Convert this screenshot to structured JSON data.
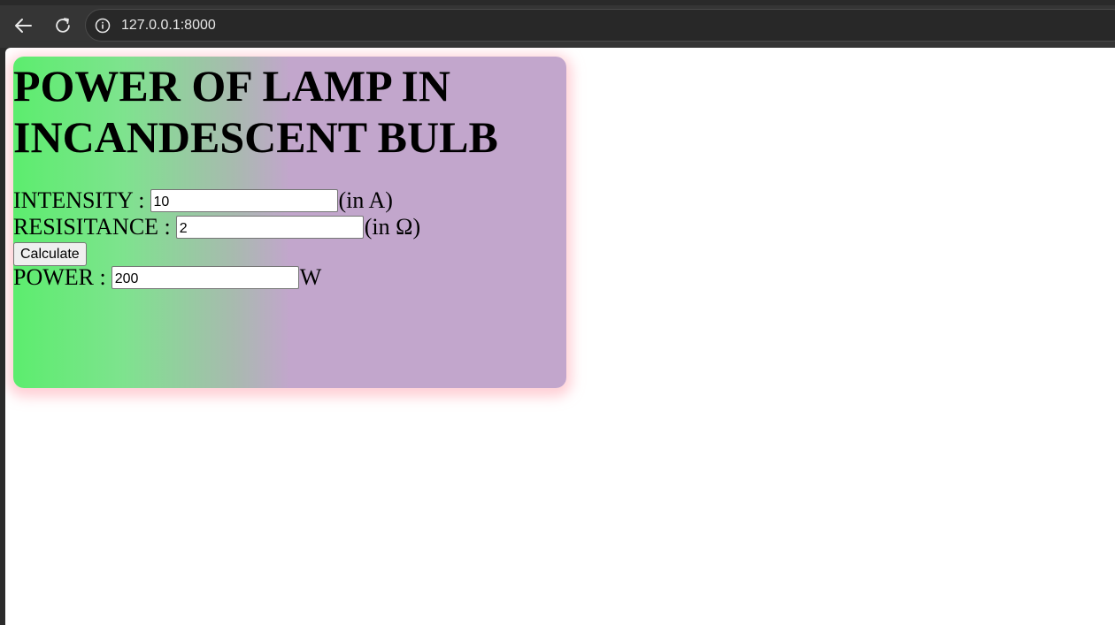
{
  "browser": {
    "url": "127.0.0.1:8000",
    "icons": [
      "back-arrow-icon",
      "reload-icon",
      "info-icon"
    ]
  },
  "page": {
    "title": "POWER OF LAMP IN INCANDESCENT BULB",
    "intensity": {
      "label": "INTENSITY :",
      "value": "10",
      "unit": "(in A)"
    },
    "resistance": {
      "label": "RESISITANCE :",
      "value": "2",
      "unit": "(in Ω)"
    },
    "calculate_label": "Calculate",
    "power": {
      "label": "POWER :",
      "value": "200",
      "unit": "W"
    }
  },
  "colors": {
    "gradient_start": "#5ced6e",
    "gradient_end": "#c2a6cc",
    "card_glow": "#ffaab4"
  }
}
